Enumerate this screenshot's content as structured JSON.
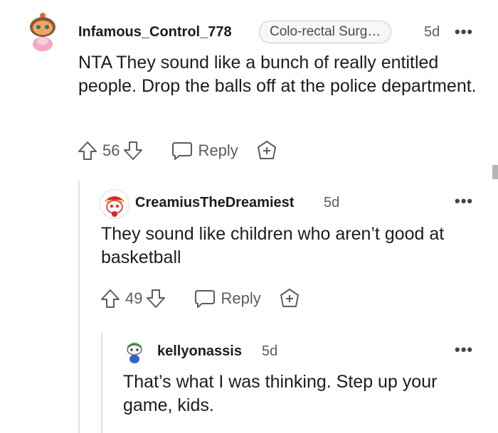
{
  "comments": [
    {
      "username": "Infamous_Control_778",
      "flair": "Colo-rectal Surg…",
      "age": "5d",
      "more": "•••",
      "body": "NTA They sound like a bunch of really entitled people. Drop the balls off at the police department.",
      "votes": "56",
      "reply_label": "Reply"
    },
    {
      "username": "CreamiusTheDreamiest",
      "age": "5d",
      "more": "•••",
      "body": "They sound like children who aren’t good at basketball",
      "votes": "49",
      "reply_label": "Reply"
    },
    {
      "username": "kellyonassis",
      "age": "5d",
      "more": "•••",
      "body": "That’s what I was thinking. Step up your game, kids."
    }
  ],
  "icons": {
    "upvote": "arrow-up-icon",
    "downvote": "arrow-down-icon",
    "reply": "speech-bubble-icon",
    "award": "award-plus-icon",
    "more": "ellipsis-icon"
  },
  "colors": {
    "background": "#ffffff",
    "text": "#1c1c1c",
    "muted": "#5c5c5c",
    "thread_line": "#e0e0e0"
  }
}
